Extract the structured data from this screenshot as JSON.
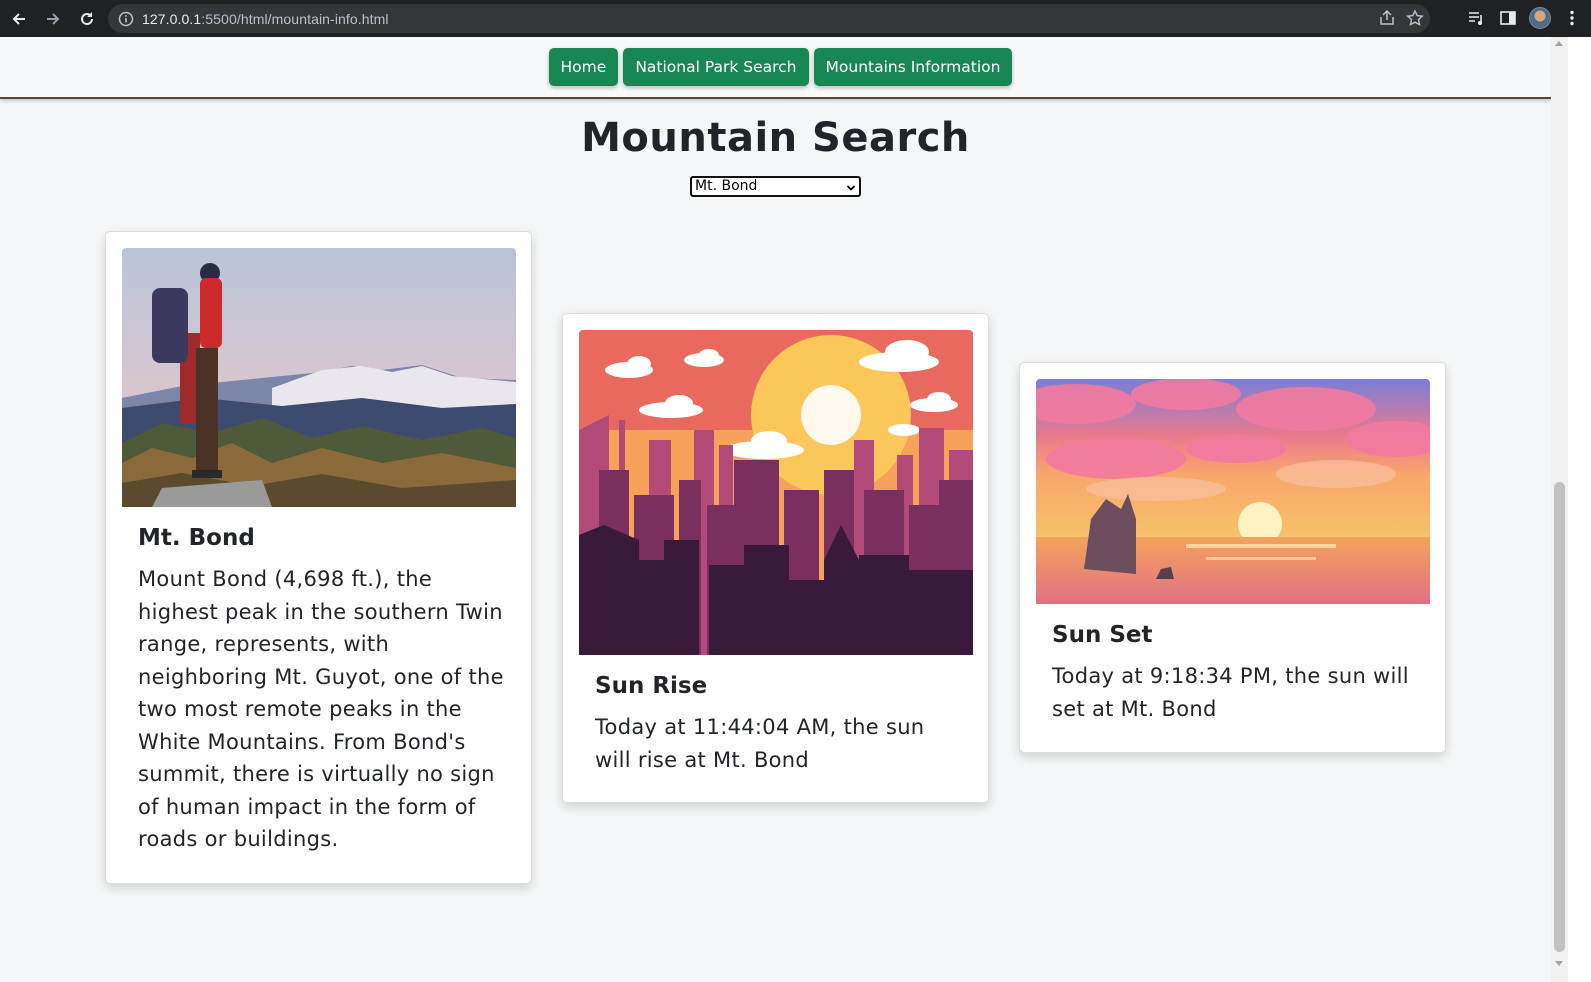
{
  "browser": {
    "url_host": "127.0.0.1",
    "url_rest": ":5500/html/mountain-info.html"
  },
  "nav": {
    "links": [
      "Home",
      "National Park Search",
      "Mountains Information"
    ]
  },
  "page": {
    "title": "Mountain Search",
    "select_value": "Mt. Bond"
  },
  "cards": {
    "mountain": {
      "title": "Mt. Bond",
      "text": "Mount Bond (4,698 ft.), the highest peak in the southern Twin range, represents, with neighboring Mt. Guyot, one of the two most remote peaks in the White Mountains. From Bond's summit, there is virtually no sign of human impact in the form of roads or buildings."
    },
    "sunrise": {
      "title": "Sun Rise",
      "text": "Today at 11:44:04 AM, the sun will rise at Mt. Bond"
    },
    "sunset": {
      "title": "Sun Set",
      "text": "Today at 9:18:34 PM, the sun will set at Mt. Bond"
    }
  },
  "colors": {
    "nav_button": "#198754",
    "page_bg": "#f4f7f7"
  }
}
